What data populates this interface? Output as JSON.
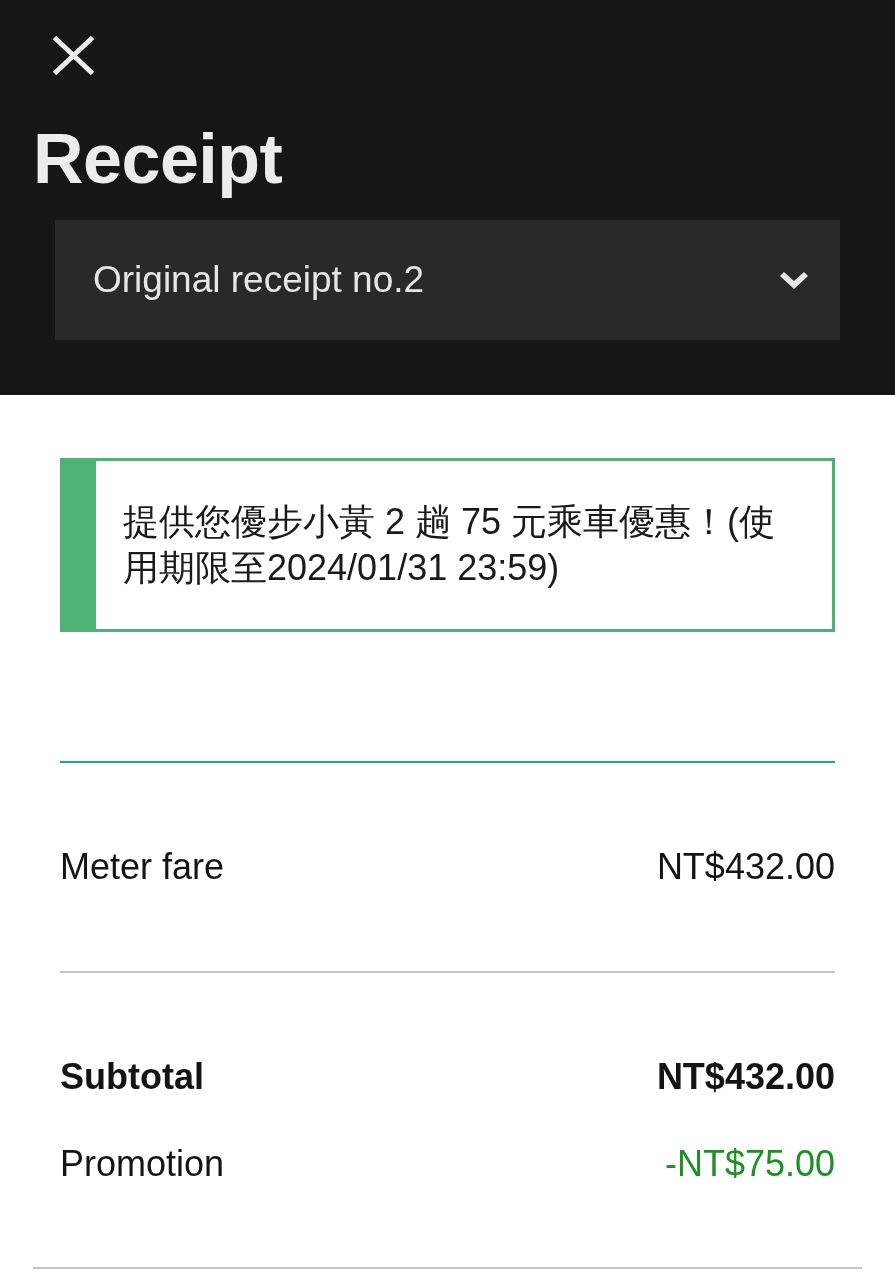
{
  "header": {
    "title": "Receipt"
  },
  "receipt_selector": {
    "value": "Original receipt no.2"
  },
  "promo_banner": {
    "text": "提供您優步小黃 2 趟 75 元乘車優惠！(使用期限至2024/01/31 23:59)"
  },
  "fare_lines": [
    {
      "kind": "line",
      "label": "Meter fare",
      "amount": "NT$432.00"
    }
  ],
  "totals": [
    {
      "kind": "total",
      "label": "Subtotal",
      "amount": "NT$432.00"
    },
    {
      "kind": "discount",
      "label": "Promotion",
      "amount": "-NT$75.00"
    }
  ]
}
